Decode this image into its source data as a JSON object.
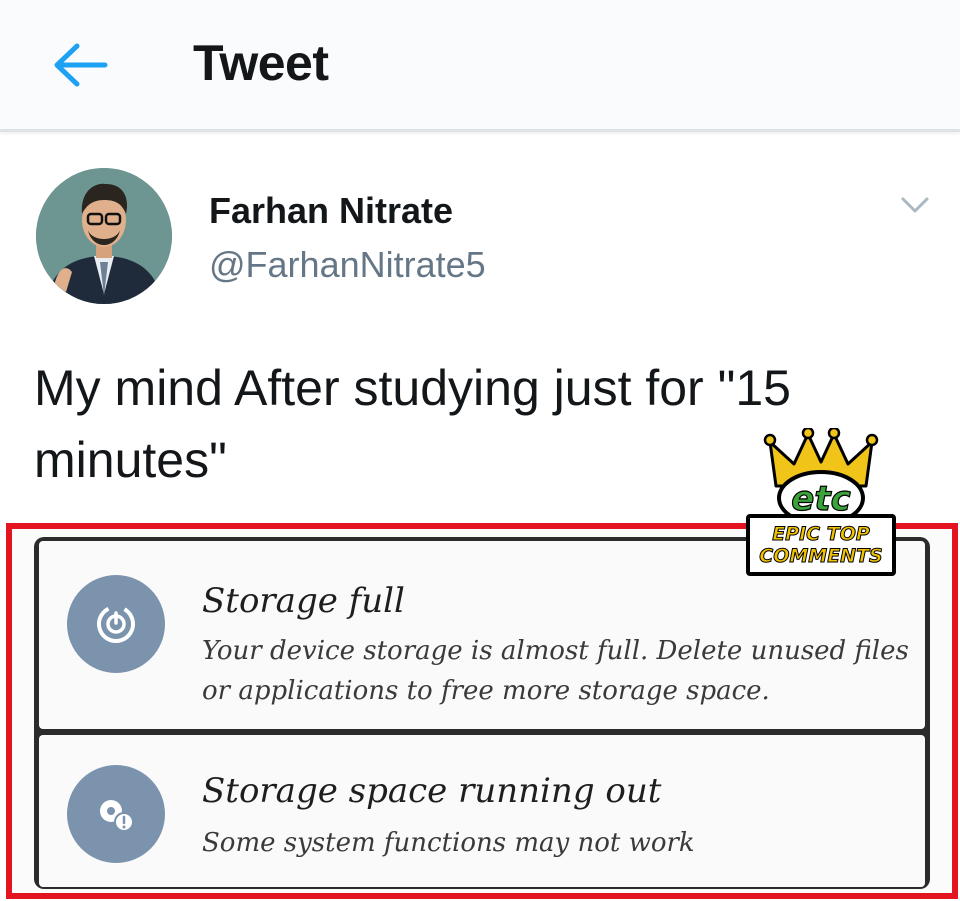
{
  "header": {
    "title": "Tweet",
    "back_icon": "arrow-left-icon",
    "accent_color": "#1da1f2"
  },
  "tweet": {
    "author_name": "Farhan Nitrate",
    "author_handle": "@FarhanNitrate5",
    "text": "My mind After studying just for \"15 minutes\"",
    "menu_icon": "chevron-down-icon"
  },
  "media": {
    "border_color": "#e3141f",
    "notifications": [
      {
        "icon": "storage-icon",
        "title": "Storage full",
        "body": "Your device storage is almost full. Delete unused files or applications to free more storage space."
      },
      {
        "icon": "storage-warning-icon",
        "title": "Storage space running out",
        "body": "Some system functions may not work"
      }
    ]
  },
  "watermark": {
    "logo_text": "etc",
    "line1": "EPIC TOP",
    "line2": "COMMENTS"
  }
}
